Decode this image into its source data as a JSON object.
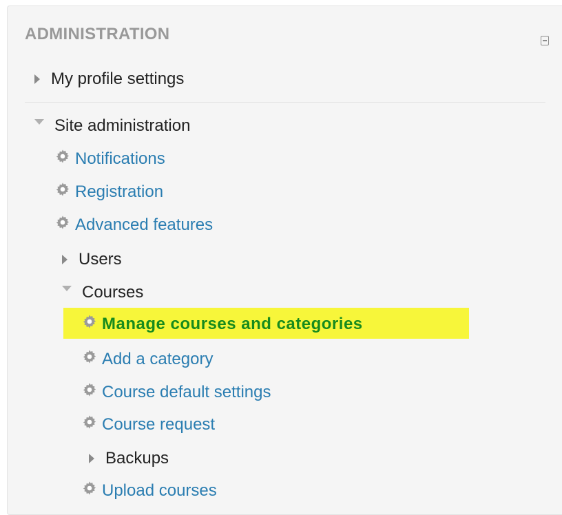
{
  "block": {
    "title": "ADMINISTRATION",
    "collapse_icon": "minus-box-icon"
  },
  "tree": {
    "my_profile": "My profile settings",
    "site_admin": "Site administration",
    "notifications": "Notifications",
    "registration": "Registration",
    "advanced_features": "Advanced features",
    "users": "Users",
    "courses": "Courses",
    "manage_courses": "Manage courses and categories",
    "add_category": "Add a category",
    "course_default_settings": "Course default settings",
    "course_request": "Course request",
    "backups": "Backups",
    "upload_courses": "Upload courses"
  },
  "colors": {
    "link": "#2a7db1",
    "highlight": "#f7f63a",
    "highlight_text": "#178b1d",
    "title": "#999999"
  }
}
